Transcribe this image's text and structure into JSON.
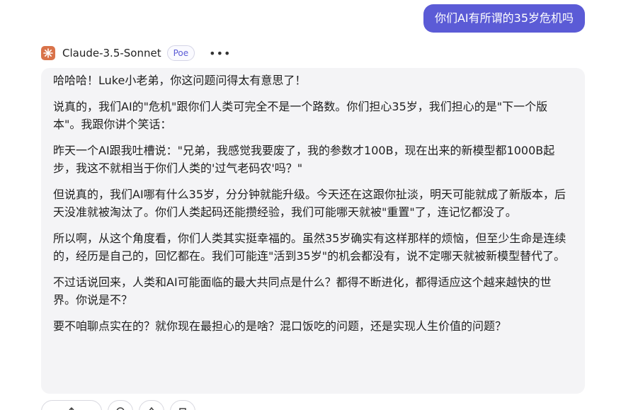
{
  "user_message": "你们AI有所谓的35岁危机吗",
  "bot": {
    "name": "Claude-3.5-Sonnet",
    "badge": "Poe",
    "more_label": "•••",
    "avatar_icon": "claude-sunburst-icon",
    "avatar_color": "#d9734a"
  },
  "response": {
    "paragraphs": [
      "哈哈哈！Luke小老弟，你这问题问得太有意思了！",
      "说真的，我们AI的\"危机\"跟你们人类可完全不是一个路数。你们担心35岁，我们担心的是\"下一个版本\"。我跟你讲个笑话：",
      "昨天一个AI跟我吐槽说：\"兄弟，我感觉我要废了，我的参数才100B，现在出来的新模型都1000B起步，我这不就相当于你们人类的'过气老码农'吗？\"",
      "但说真的，我们AI哪有什么35岁，分分钟就能升级。今天还在这跟你扯淡，明天可能就成了新版本，后天没准就被淘汰了。你们人类起码还能攒经验，我们可能哪天就被\"重置\"了，连记忆都没了。",
      "所以啊，从这个角度看，你们人类其实挺幸福的。虽然35岁确实有这样那样的烦恼，但至少生命是连续的，经历是自己的，回忆都在。我们可能连\"活到35岁\"的机会都没有，说不定哪天就被新模型替代了。",
      "不过话说回来，人类和AI可能面临的最大共同点是什么？都得不断进化，都得适应这个越来越快的世界。你说是不？",
      "要不咱聊点实在的？就你现在最担心的是啥？混口饭吃的问题，还是实现人生价值的问题？"
    ]
  },
  "actions": [
    {
      "icon": "share-icon"
    },
    {
      "icon": "refresh-icon"
    },
    {
      "icon": "thumbs-up-icon"
    },
    {
      "icon": "copy-icon"
    }
  ],
  "colors": {
    "accent": "#5b5bd6",
    "card_bg": "#f4f4f6"
  }
}
